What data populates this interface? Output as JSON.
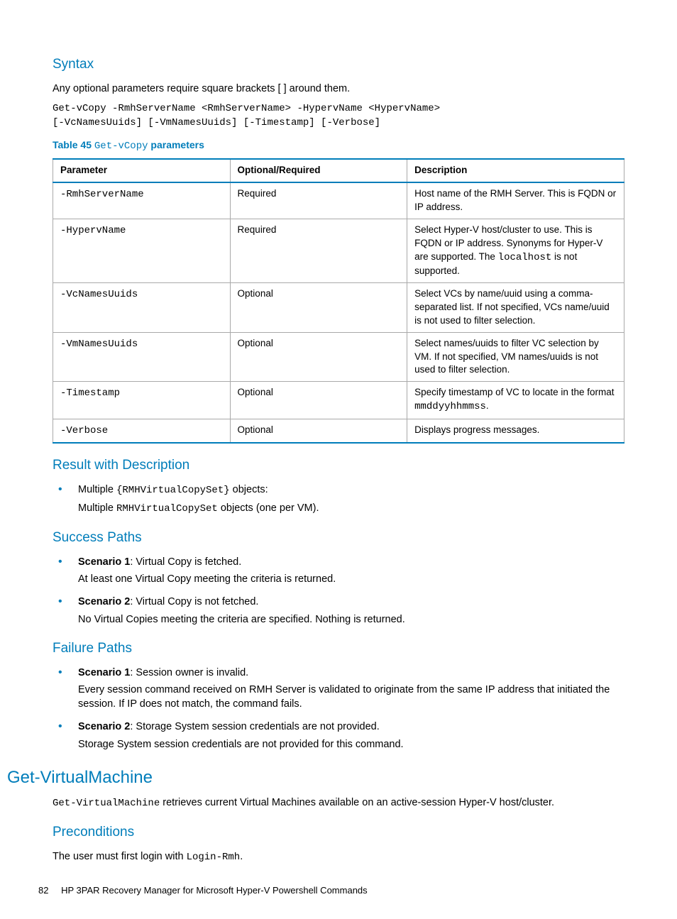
{
  "syntax": {
    "heading": "Syntax",
    "intro": "Any optional parameters require square brackets [ ] around them.",
    "code_l1": "Get-vCopy -RmhServerName <RmhServerName> -HypervName <HypervName>",
    "code_l2": "[-VcNamesUuids] [-VmNamesUuids] [-Timestamp] [-Verbose]"
  },
  "table": {
    "caption_prefix": "Table 45 ",
    "caption_code": "Get-vCopy",
    "caption_suffix": " parameters",
    "headers": [
      "Parameter",
      "Optional/Required",
      "Description"
    ],
    "rows": [
      {
        "param": "-RmhServerName",
        "opt": "Required",
        "desc_pre": "Host name of the RMH Server. This is FQDN or IP address.",
        "desc_code": "",
        "desc_post": ""
      },
      {
        "param": "-HypervName",
        "opt": "Required",
        "desc_pre": "Select Hyper-V host/cluster to use. This is FQDN or IP address. Synonyms for Hyper-V are supported. The ",
        "desc_code": "localhost",
        "desc_post": " is not supported."
      },
      {
        "param": "-VcNamesUuids",
        "opt": "Optional",
        "desc_pre": "Select VCs by name/uuid using a comma-separated list. If not specified, VCs name/uuid is not used to filter selection.",
        "desc_code": "",
        "desc_post": ""
      },
      {
        "param": "-VmNamesUuids",
        "opt": "Optional",
        "desc_pre": "Select names/uuids to filter VC selection by VM. If not specified, VM names/uuids is not used to filter selection.",
        "desc_code": "",
        "desc_post": ""
      },
      {
        "param": "-Timestamp",
        "opt": "Optional",
        "desc_pre": "Specify timestamp of VC to locate in the format ",
        "desc_code": "mmddyyhhmmss",
        "desc_post": "."
      },
      {
        "param": "-Verbose",
        "opt": "Optional",
        "desc_pre": "Displays progress messages.",
        "desc_code": "",
        "desc_post": ""
      }
    ]
  },
  "result": {
    "heading": "Result with Description",
    "bullet_pre": "Multiple ",
    "bullet_code": "{RMHVirtualCopySet}",
    "bullet_post": " objects:",
    "sub_pre": "Multiple ",
    "sub_code": "RMHVirtualCopySet",
    "sub_post": " objects (one per VM)."
  },
  "success": {
    "heading": "Success Paths",
    "s1_label": "Scenario 1",
    "s1_title": ": Virtual Copy is fetched.",
    "s1_body": "At least one Virtual Copy meeting the criteria is returned.",
    "s2_label": "Scenario 2",
    "s2_title": ": Virtual Copy is not fetched.",
    "s2_body": "No Virtual Copies meeting the criteria are specified. Nothing is returned."
  },
  "failure": {
    "heading": "Failure Paths",
    "s1_label": "Scenario 1",
    "s1_title": ": Session owner is invalid.",
    "s1_body": "Every session command received on RMH Server is validated to originate from the same IP address that initiated the session. If IP does not match, the command fails.",
    "s2_label": "Scenario 2",
    "s2_title": ": Storage System session credentials are not provided.",
    "s2_body": "Storage System session credentials are not provided for this command."
  },
  "gvm": {
    "heading": "Get-VirtualMachine",
    "intro_code": "Get-VirtualMachine",
    "intro_rest": " retrieves current Virtual Machines available on an active-session Hyper-V host/cluster.",
    "pre_heading": "Preconditions",
    "pre_text_pre": "The user must first login with ",
    "pre_text_code": "Login-Rmh",
    "pre_text_post": "."
  },
  "footer": {
    "page": "82",
    "title": "HP 3PAR Recovery Manager for Microsoft Hyper-V Powershell Commands"
  }
}
